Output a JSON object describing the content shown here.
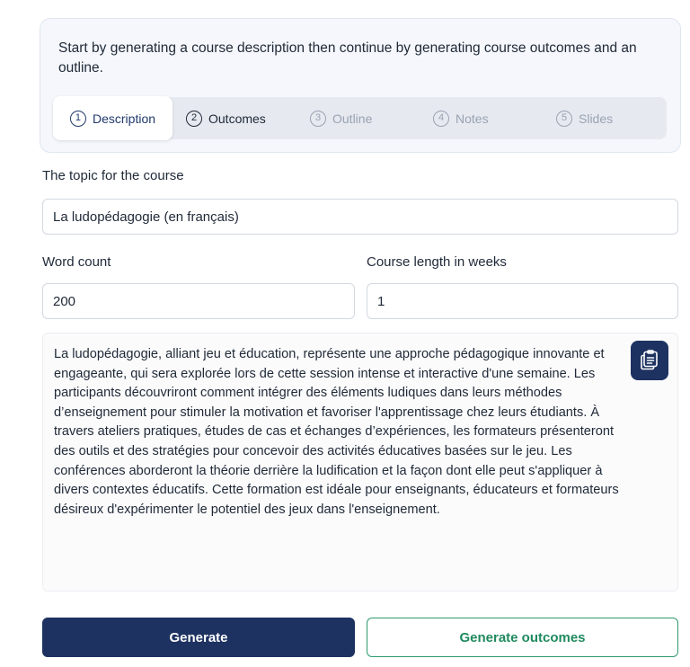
{
  "intro": {
    "text": "Start by generating a course description then continue by generating course outcomes and an outline."
  },
  "steps": [
    {
      "num": "1",
      "label": "Description",
      "state": "active"
    },
    {
      "num": "2",
      "label": "Outcomes",
      "state": "done"
    },
    {
      "num": "3",
      "label": "Outline",
      "state": "pending"
    },
    {
      "num": "4",
      "label": "Notes",
      "state": "pending"
    },
    {
      "num": "5",
      "label": "Slides",
      "state": "pending"
    }
  ],
  "form": {
    "topic_label": "The topic for the course",
    "topic_value": "La ludopédagogie (en français)",
    "word_count_label": "Word count",
    "word_count_value": "200",
    "course_length_label": "Course length in weeks",
    "course_length_value": "1"
  },
  "output": {
    "text": "La ludopédagogie, alliant jeu et éducation, représente une approche pédagogique innovante et engageante, qui sera explorée lors de cette session intense et interactive d'une semaine. Les participants découvriront comment intégrer des éléments ludiques dans leurs méthodes d’enseignement pour stimuler la motivation et favoriser l'apprentissage chez leurs étudiants. À travers ateliers pratiques, études de cas et échanges d’expériences, les formateurs présenteront des outils et des stratégies pour concevoir des activités éducatives basées sur le jeu. Les conférences aborderont la théorie derrière la ludification et la façon dont elle peut s'appliquer à divers contextes éducatifs. Cette formation est idéale pour enseignants, éducateurs et formateurs désireux d'expérimenter le potentiel des jeux dans l'enseignement.",
    "copy_icon": "clipboard-copy-icon"
  },
  "buttons": {
    "generate": "Generate",
    "generate_outcomes": "Generate outcomes"
  },
  "colors": {
    "primary": "#1d3260",
    "accent_green": "#1f8a5f",
    "stepper_bg": "#e6e9ef",
    "card_bg": "#f5f7fc"
  }
}
